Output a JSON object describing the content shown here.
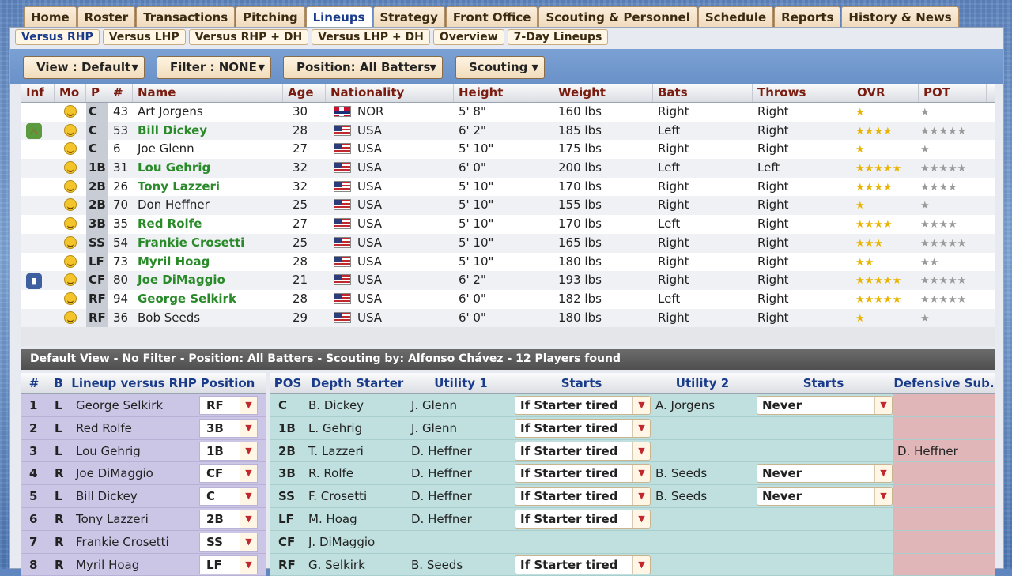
{
  "main_tabs": [
    "Home",
    "Roster",
    "Transactions",
    "Pitching",
    "Lineups",
    "Strategy",
    "Front Office",
    "Scouting & Personnel",
    "Schedule",
    "Reports",
    "History & News"
  ],
  "main_tab_active": "Lineups",
  "sub_tabs": [
    "Versus RHP",
    "Versus LHP",
    "Versus RHP + DH",
    "Versus LHP + DH",
    "Overview",
    "7-Day Lineups"
  ],
  "sub_tab_active": "Versus RHP",
  "filters": {
    "view": "View : Default",
    "filter": "Filter : NONE",
    "position": "Position: All Batters",
    "scouting": "Scouting"
  },
  "player_table": {
    "headers": [
      "Inf",
      "Mo",
      "P",
      "#",
      "Name",
      "Age",
      "Nationality",
      "Height",
      "Weight",
      "Bats",
      "Throws",
      "OVR",
      "POT"
    ],
    "rows": [
      {
        "inf": "",
        "pos": "C",
        "num": "43",
        "name": "Art Jorgens",
        "green": false,
        "age": "30",
        "flag": "nor",
        "nat": "NOR",
        "height": "5' 8\"",
        "weight": "160 lbs",
        "bats": "Right",
        "throws": "Right",
        "ovr": 1,
        "pot": 1
      },
      {
        "inf": "fire",
        "pos": "C",
        "num": "53",
        "name": "Bill Dickey",
        "green": true,
        "age": "28",
        "flag": "usa",
        "nat": "USA",
        "height": "6' 2\"",
        "weight": "185 lbs",
        "bats": "Left",
        "throws": "Right",
        "ovr": 4,
        "pot": 5
      },
      {
        "inf": "",
        "pos": "C",
        "num": "6",
        "name": "Joe Glenn",
        "green": false,
        "age": "27",
        "flag": "usa",
        "nat": "USA",
        "height": "5' 10\"",
        "weight": "175 lbs",
        "bats": "Right",
        "throws": "Right",
        "ovr": 1,
        "pot": 1
      },
      {
        "inf": "",
        "pos": "1B",
        "num": "31",
        "name": "Lou Gehrig",
        "green": true,
        "age": "32",
        "flag": "usa",
        "nat": "USA",
        "height": "6' 0\"",
        "weight": "200 lbs",
        "bats": "Left",
        "throws": "Left",
        "ovr": 5,
        "pot": 5
      },
      {
        "inf": "",
        "pos": "2B",
        "num": "26",
        "name": "Tony Lazzeri",
        "green": true,
        "age": "32",
        "flag": "usa",
        "nat": "USA",
        "height": "5' 10\"",
        "weight": "170 lbs",
        "bats": "Right",
        "throws": "Right",
        "ovr": 4,
        "pot": 4
      },
      {
        "inf": "",
        "pos": "2B",
        "num": "70",
        "name": "Don Heffner",
        "green": false,
        "age": "25",
        "flag": "usa",
        "nat": "USA",
        "height": "5' 10\"",
        "weight": "155 lbs",
        "bats": "Right",
        "throws": "Right",
        "ovr": 1,
        "pot": 1
      },
      {
        "inf": "",
        "pos": "3B",
        "num": "35",
        "name": "Red Rolfe",
        "green": true,
        "age": "27",
        "flag": "usa",
        "nat": "USA",
        "height": "5' 10\"",
        "weight": "170 lbs",
        "bats": "Left",
        "throws": "Right",
        "ovr": 3.5,
        "pot": 4
      },
      {
        "inf": "",
        "pos": "SS",
        "num": "54",
        "name": "Frankie Crosetti",
        "green": true,
        "age": "25",
        "flag": "usa",
        "nat": "USA",
        "height": "5' 10\"",
        "weight": "165 lbs",
        "bats": "Right",
        "throws": "Right",
        "ovr": 3,
        "pot": 4.5
      },
      {
        "inf": "",
        "pos": "LF",
        "num": "73",
        "name": "Myril Hoag",
        "green": true,
        "age": "28",
        "flag": "usa",
        "nat": "USA",
        "height": "5' 10\"",
        "weight": "180 lbs",
        "bats": "Right",
        "throws": "Right",
        "ovr": 2,
        "pot": 2
      },
      {
        "inf": "info",
        "pos": "CF",
        "num": "80",
        "name": "Joe DiMaggio",
        "green": true,
        "age": "21",
        "flag": "usa",
        "nat": "USA",
        "height": "6' 2\"",
        "weight": "193 lbs",
        "bats": "Right",
        "throws": "Right",
        "ovr": 4.5,
        "pot": 5
      },
      {
        "inf": "",
        "pos": "RF",
        "num": "94",
        "name": "George Selkirk",
        "green": true,
        "age": "28",
        "flag": "usa",
        "nat": "USA",
        "height": "6' 0\"",
        "weight": "182 lbs",
        "bats": "Left",
        "throws": "Right",
        "ovr": 5,
        "pot": 5
      },
      {
        "inf": "",
        "pos": "RF",
        "num": "36",
        "name": "Bob Seeds",
        "green": false,
        "age": "29",
        "flag": "usa",
        "nat": "USA",
        "height": "6' 0\"",
        "weight": "180 lbs",
        "bats": "Right",
        "throws": "Right",
        "ovr": 1,
        "pot": 1
      }
    ]
  },
  "status_text": "Default View - No Filter - Position: All Batters - Scouting by: Alfonso Chávez - 12 Players found",
  "lineup": {
    "headers": [
      "#",
      "B",
      "Lineup versus RHP",
      "Position"
    ],
    "rows": [
      {
        "n": "1",
        "b": "L",
        "name": "George Selkirk",
        "pos": "RF"
      },
      {
        "n": "2",
        "b": "L",
        "name": "Red Rolfe",
        "pos": "3B"
      },
      {
        "n": "3",
        "b": "L",
        "name": "Lou Gehrig",
        "pos": "1B"
      },
      {
        "n": "4",
        "b": "R",
        "name": "Joe DiMaggio",
        "pos": "CF"
      },
      {
        "n": "5",
        "b": "L",
        "name": "Bill Dickey",
        "pos": "C"
      },
      {
        "n": "6",
        "b": "R",
        "name": "Tony Lazzeri",
        "pos": "2B"
      },
      {
        "n": "7",
        "b": "R",
        "name": "Frankie Crosetti",
        "pos": "SS"
      },
      {
        "n": "8",
        "b": "R",
        "name": "Myril Hoag",
        "pos": "LF"
      }
    ]
  },
  "depth": {
    "headers": [
      "POS",
      "Depth Starter",
      "Utility 1",
      "Starts",
      "Utility 2",
      "Starts",
      "Defensive Sub."
    ],
    "rows": [
      {
        "pos": "C",
        "starter": "B. Dickey",
        "u1": "J. Glenn",
        "s1": "If Starter tired",
        "u2": "A. Jorgens",
        "s2": "Never",
        "sub": ""
      },
      {
        "pos": "1B",
        "starter": "L. Gehrig",
        "u1": "J. Glenn",
        "s1": "If Starter tired",
        "u2": "",
        "s2": "",
        "sub": ""
      },
      {
        "pos": "2B",
        "starter": "T. Lazzeri",
        "u1": "D. Heffner",
        "s1": "If Starter tired",
        "u2": "",
        "s2": "",
        "sub": "D. Heffner"
      },
      {
        "pos": "3B",
        "starter": "R. Rolfe",
        "u1": "D. Heffner",
        "s1": "If Starter tired",
        "u2": "B. Seeds",
        "s2": "Never",
        "sub": ""
      },
      {
        "pos": "SS",
        "starter": "F. Crosetti",
        "u1": "D. Heffner",
        "s1": "If Starter tired",
        "u2": "B. Seeds",
        "s2": "Never",
        "sub": ""
      },
      {
        "pos": "LF",
        "starter": "M. Hoag",
        "u1": "D. Heffner",
        "s1": "If Starter tired",
        "u2": "",
        "s2": "",
        "sub": ""
      },
      {
        "pos": "CF",
        "starter": "J. DiMaggio",
        "u1": "",
        "s1": "",
        "u2": "",
        "s2": "",
        "sub": ""
      },
      {
        "pos": "RF",
        "starter": "G. Selkirk",
        "u1": "B. Seeds",
        "s1": "If Starter tired",
        "u2": "",
        "s2": "",
        "sub": ""
      }
    ]
  }
}
